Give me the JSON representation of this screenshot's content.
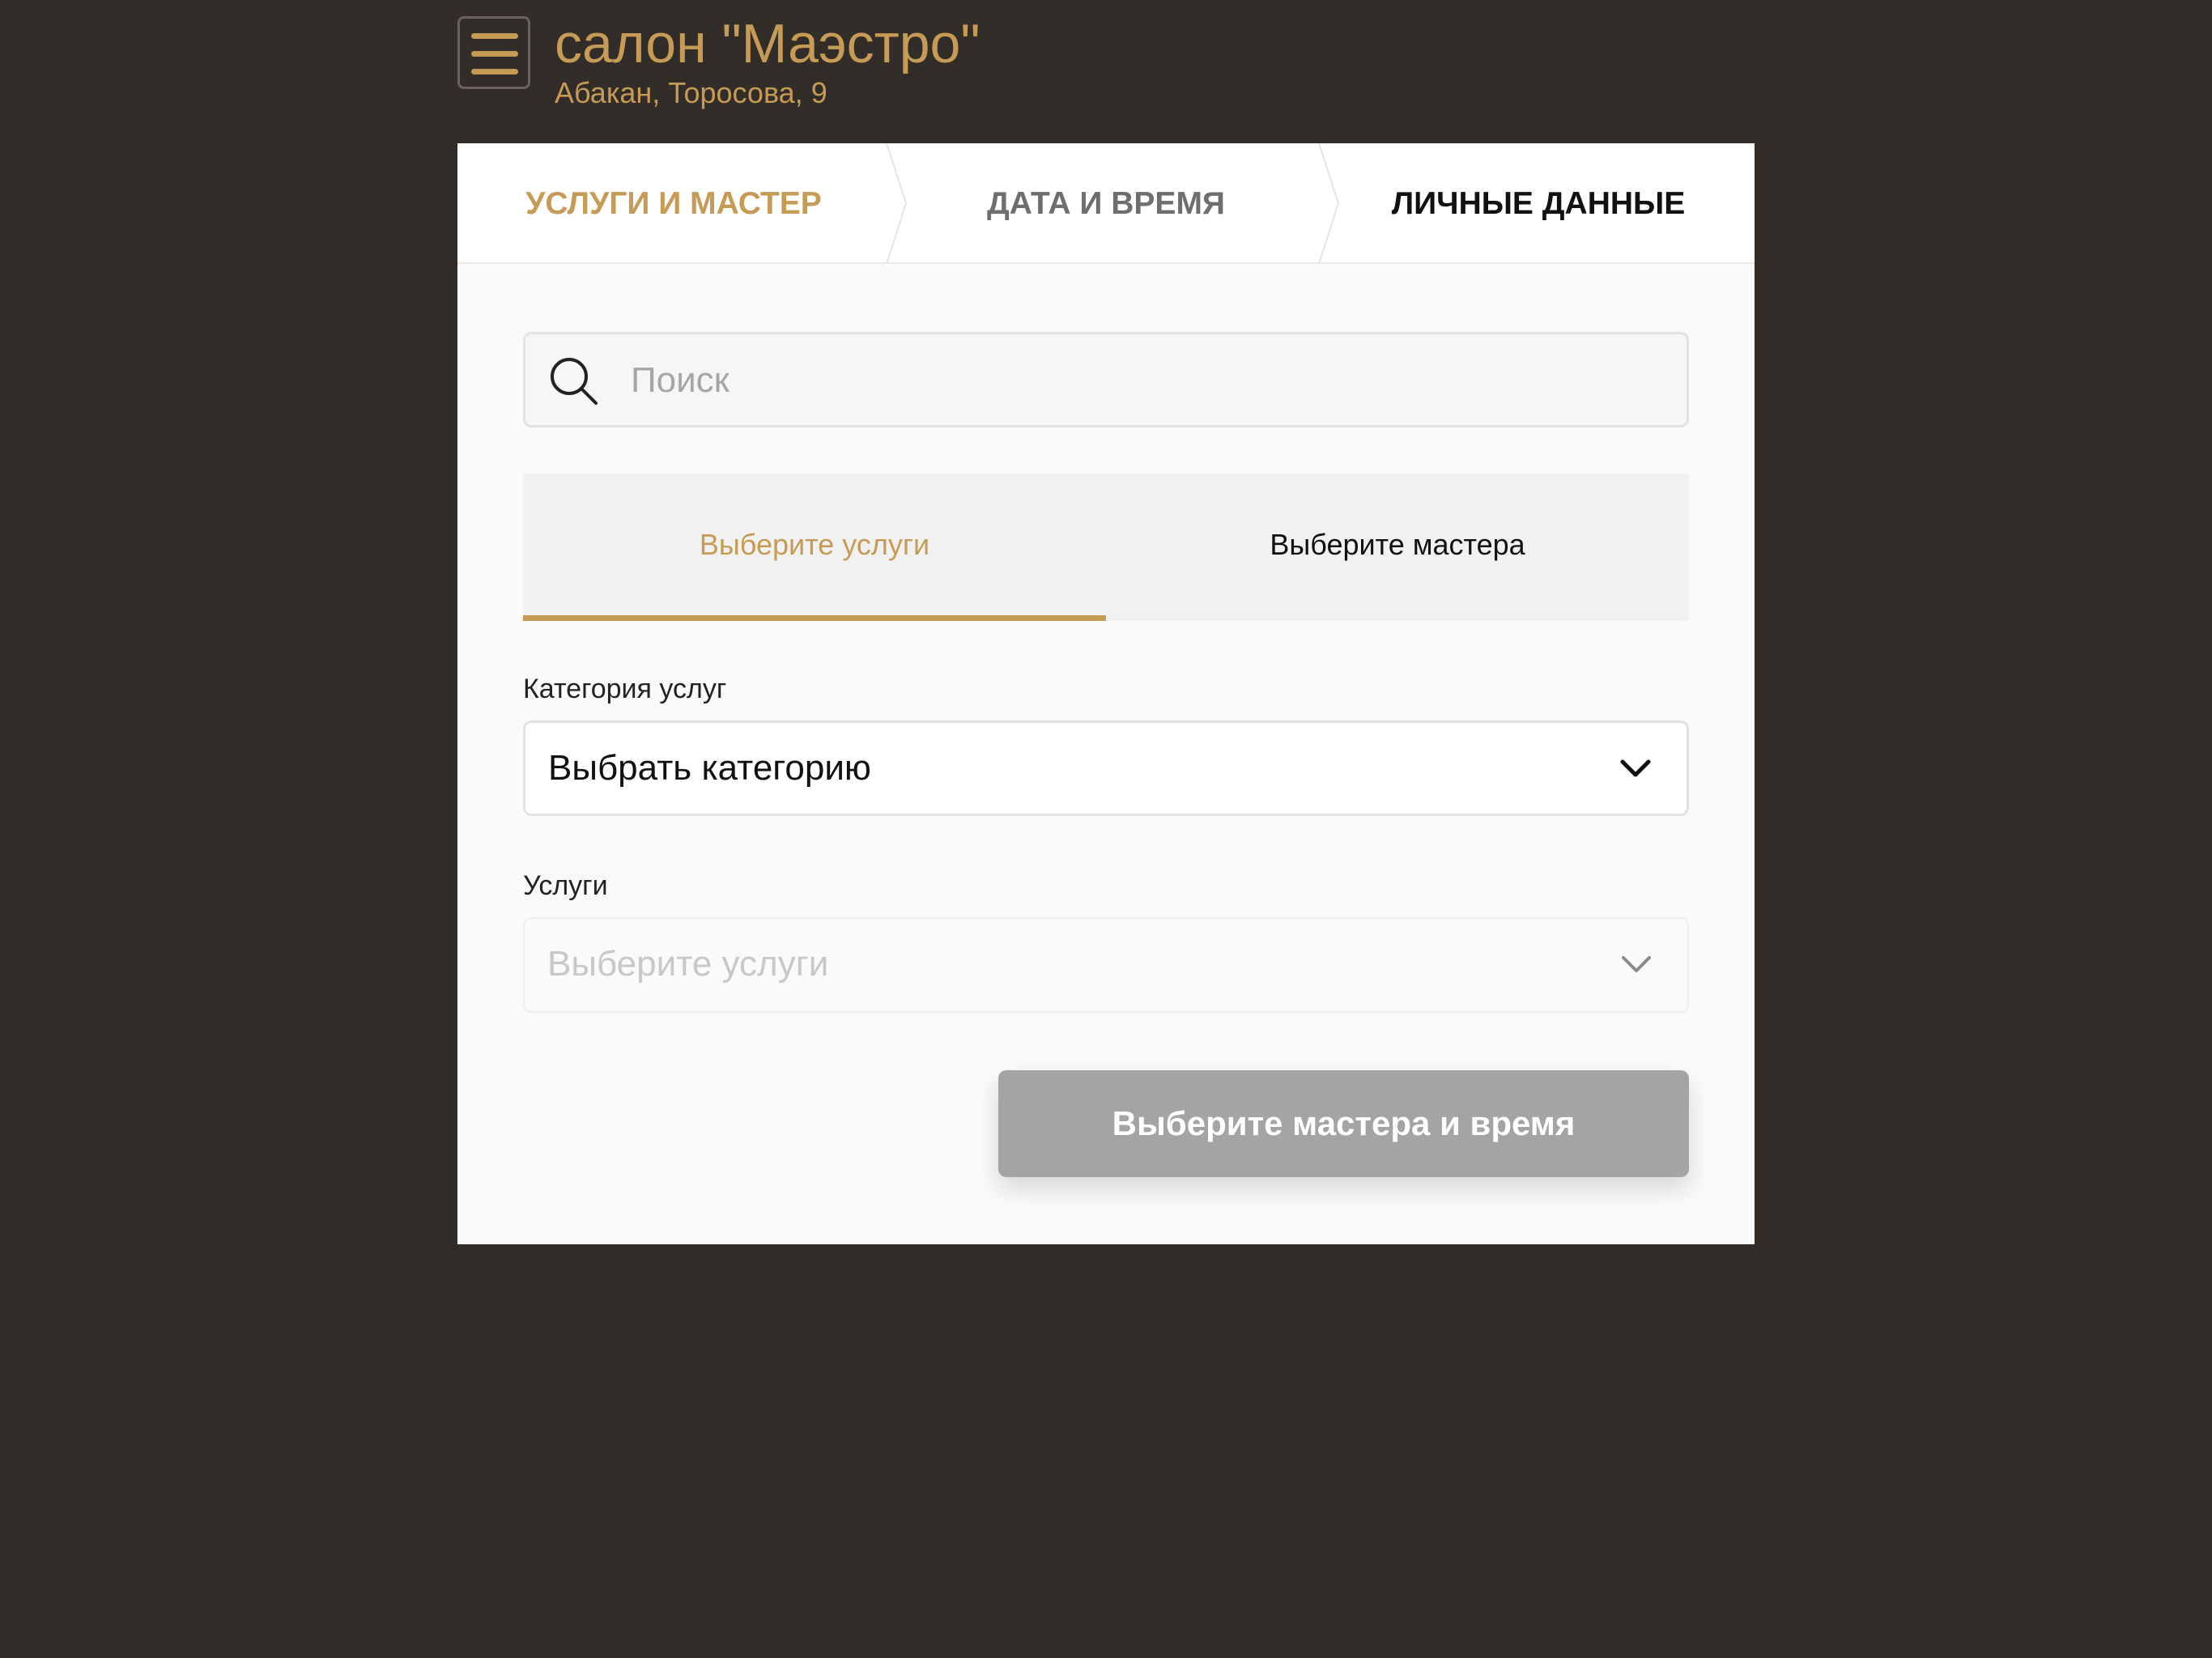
{
  "header": {
    "title": "салон \"Маэстро\"",
    "address": "Абакан, Торосова, 9"
  },
  "steps": [
    {
      "label": "УСЛУГИ И МАСТЕР",
      "state": "active"
    },
    {
      "label": "ДАТА И ВРЕМЯ",
      "state": "inactive"
    },
    {
      "label": "ЛИЧНЫЕ ДАННЫЕ",
      "state": "inactive"
    }
  ],
  "search": {
    "placeholder": "Поиск",
    "value": ""
  },
  "tabs": [
    {
      "label": "Выберите услуги",
      "active": true
    },
    {
      "label": "Выберите мастера",
      "active": false
    }
  ],
  "form": {
    "category_label": "Категория услуг",
    "category_value": "Выбрать категорию",
    "services_label": "Услуги",
    "services_placeholder": "Выберите услуги"
  },
  "submit": {
    "label": "Выберите мастера и время",
    "disabled": true
  },
  "colors": {
    "background": "#332d2a",
    "accent": "#c59b56",
    "panel": "#fafafa",
    "button_disabled": "#a4a4a4"
  },
  "icons": {
    "menu": "hamburger-menu-icon",
    "search": "search-icon",
    "select": "chevron-down-icon"
  }
}
